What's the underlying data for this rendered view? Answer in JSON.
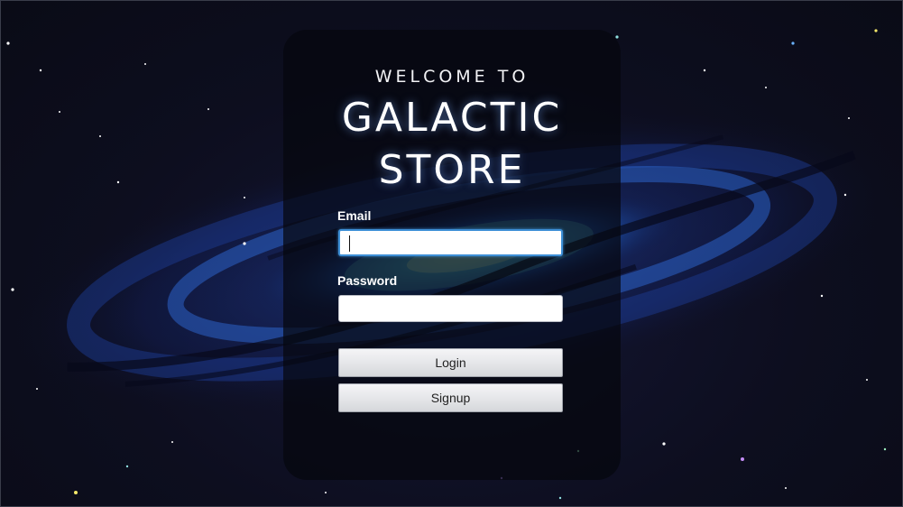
{
  "header": {
    "welcome": "WELCOME TO",
    "title_line_1": "GALACTIC",
    "title_line_2": "STORE"
  },
  "form": {
    "email_label": "Email",
    "email_value": "",
    "password_label": "Password",
    "password_value": "",
    "login_label": "Login",
    "signup_label": "Signup"
  },
  "colors": {
    "background": "#0c0d1a",
    "panel": "rgba(6, 7, 14, 0.72)",
    "galaxy_core": "#2f7fe0",
    "focus_ring": "#3d8fd6"
  }
}
